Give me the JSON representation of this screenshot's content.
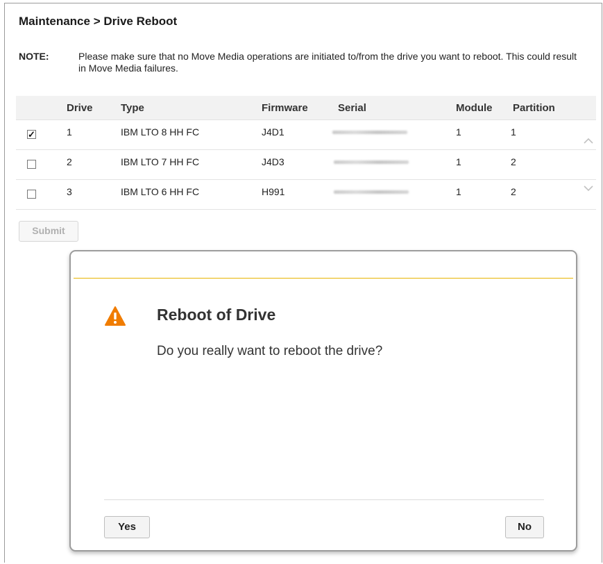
{
  "breadcrumb": "Maintenance > Drive Reboot",
  "note": {
    "label": "NOTE:",
    "text": "Please make sure that no Move Media operations are initiated to/from the drive you want to reboot. This could result in Move Media failures."
  },
  "table": {
    "columns": [
      "Drive",
      "Type",
      "Firmware",
      "Serial",
      "Module",
      "Partition"
    ],
    "rows": [
      {
        "checked": true,
        "drive": "1",
        "type": "IBM LTO 8 HH FC",
        "firmware": "J4D1",
        "module": "1",
        "partition": "1"
      },
      {
        "checked": false,
        "drive": "2",
        "type": "IBM LTO 7 HH FC",
        "firmware": "J4D3",
        "module": "1",
        "partition": "2"
      },
      {
        "checked": false,
        "drive": "3",
        "type": "IBM LTO 6 HH FC",
        "firmware": "H991",
        "module": "1",
        "partition": "2"
      }
    ],
    "check_glyph": "✓"
  },
  "submit_label": "Submit",
  "dialog": {
    "title": "Reboot of Drive",
    "message": "Do you really want to reboot the drive?",
    "yes_label": "Yes",
    "no_label": "No",
    "icon": "warning-icon",
    "accent_color": "#e8b400",
    "warning_color": "#f07c00"
  },
  "icons": {
    "scroll_up": "chevron-up-icon",
    "scroll_down": "chevron-down-icon"
  }
}
